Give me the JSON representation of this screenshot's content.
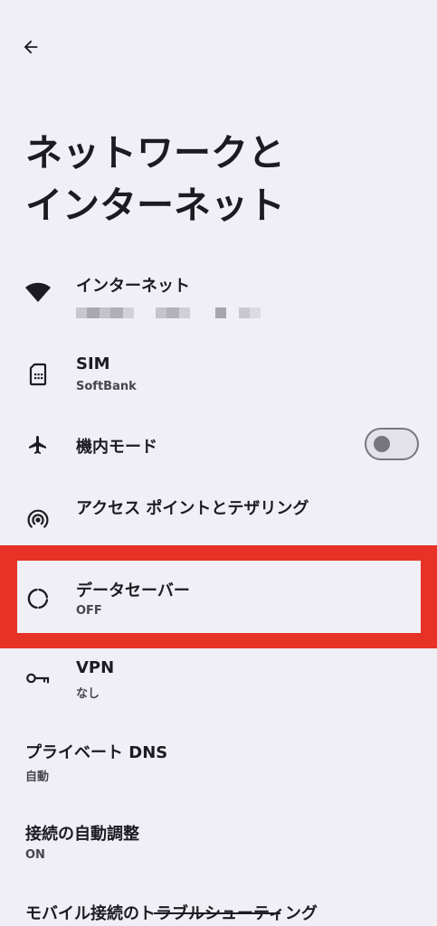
{
  "header": {
    "back_icon": "arrow-back-icon",
    "title": "ネットワークと\nインターネット"
  },
  "settings": {
    "internet": {
      "title": "インターネット",
      "icon": "wifi-icon",
      "summary_blurred": true
    },
    "sim": {
      "title": "SIM",
      "summary": "SoftBank",
      "icon": "sim-card-icon"
    },
    "airplane": {
      "title": "機内モード",
      "icon": "airplane-icon",
      "toggle_on": false
    },
    "hotspot": {
      "title": "アクセス ポイントとテザリング",
      "icon": "hotspot-icon"
    },
    "data_saver": {
      "title": "データセーバー",
      "summary": "OFF",
      "icon": "data-saver-icon",
      "highlighted": true
    },
    "vpn": {
      "title": "VPN",
      "summary": "なし",
      "icon": "vpn-key-icon"
    },
    "private_dns": {
      "title": "プライベート DNS",
      "summary": "自動"
    },
    "adaptive": {
      "title": "接続の自動調整",
      "summary": "ON"
    },
    "troubleshoot": {
      "title": "モバイル接続のトラブルシューティング"
    }
  },
  "colors": {
    "background": "#f0eff5",
    "text_primary": "#1b1b21",
    "text_secondary": "#45464f",
    "highlight": "#e63325",
    "toggle_outline": "#77767f"
  }
}
